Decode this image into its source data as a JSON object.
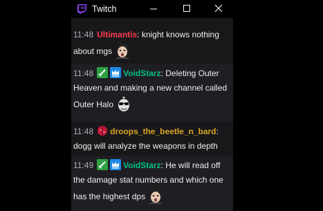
{
  "window": {
    "title": "Twitch"
  },
  "chat": {
    "messages": [
      {
        "time": "11:48",
        "user": "Ultimantis",
        "user_color": "#ff3b4e",
        "badges": [],
        "text": ": knight knows nothing about mgs",
        "emote": "pog-face-emote",
        "alt": false
      },
      {
        "time": "11:48",
        "user": "VoidStarz",
        "user_color": "#00c08b",
        "badges": [
          "sword-badge",
          "crown-badge"
        ],
        "text": ": Deleting Outer Heaven and making a new channel called Outer Halo",
        "emote": "sunglasses-face-emote",
        "alt": true
      },
      {
        "time": "11:48",
        "user": "droops_the_beetle_n_bard",
        "user_color": "#daa520",
        "badges": [
          "beetle-badge"
        ],
        "text": ": dogg will analyze the weapons in depth",
        "emote": "",
        "alt": false
      },
      {
        "time": "11:49",
        "user": "VoidStarz",
        "user_color": "#00c08b",
        "badges": [
          "sword-badge",
          "crown-badge"
        ],
        "text": ": He will read off the damage stat numbers and which one has the highest dps",
        "emote": "pog-face-emote",
        "alt": true
      }
    ]
  }
}
